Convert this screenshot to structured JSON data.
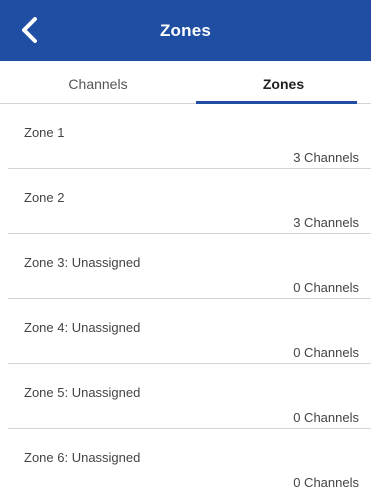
{
  "app_bar": {
    "title": "Zones",
    "back_icon": "chevron-left-icon",
    "background_color": "#1f4ea3"
  },
  "tabs": [
    {
      "label": "Channels",
      "active": false
    },
    {
      "label": "Zones",
      "active": true
    }
  ],
  "zones": [
    {
      "name": "Zone 1",
      "channels": "3 Channels"
    },
    {
      "name": "Zone 2",
      "channels": "3 Channels"
    },
    {
      "name": "Zone 3: Unassigned",
      "channels": "0 Channels"
    },
    {
      "name": "Zone 4: Unassigned",
      "channels": "0 Channels"
    },
    {
      "name": "Zone 5: Unassigned",
      "channels": "0 Channels"
    },
    {
      "name": "Zone 6: Unassigned",
      "channels": "0 Channels"
    }
  ]
}
